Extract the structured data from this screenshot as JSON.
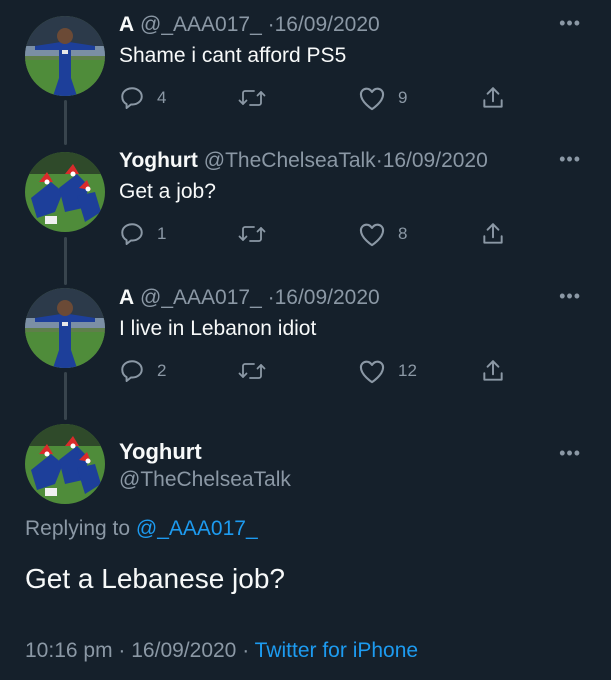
{
  "thread": [
    {
      "name": "A",
      "handle": "@_AAA017_",
      "separator": "·",
      "date": "16/09/2020",
      "text": "Shame i cant afford PS5",
      "replies": "4",
      "retweets": "",
      "likes": "9"
    },
    {
      "name": "Yoghurt",
      "handle": "@TheChelseaTalk",
      "separator": "·",
      "date": "16/09/2020",
      "text": "Get a job?",
      "replies": "1",
      "retweets": "",
      "likes": "8"
    },
    {
      "name": "A",
      "handle": "@_AAA017_",
      "separator": "·",
      "date": "16/09/2020",
      "text": "I live in Lebanon idiot",
      "replies": "2",
      "retweets": "",
      "likes": "12"
    }
  ],
  "main_tweet": {
    "name": "Yoghurt",
    "handle": "@TheChelseaTalk",
    "replying_prefix": "Replying to",
    "replying_to": "@_AAA017_",
    "text": "Get a Lebanese job?",
    "time": "10:16 pm",
    "separator": "·",
    "date": "16/09/2020",
    "separator2": "·",
    "source": "Twitter for iPhone"
  },
  "icons": {
    "more": "more-icon",
    "reply": "reply-icon",
    "retweet": "retweet-icon",
    "like": "like-icon",
    "share": "share-icon"
  },
  "colors": {
    "background": "#15202b",
    "text": "#f7f9f9",
    "muted": "#8b98a5",
    "link": "#1d9bf0"
  },
  "more_glyph": "•••"
}
